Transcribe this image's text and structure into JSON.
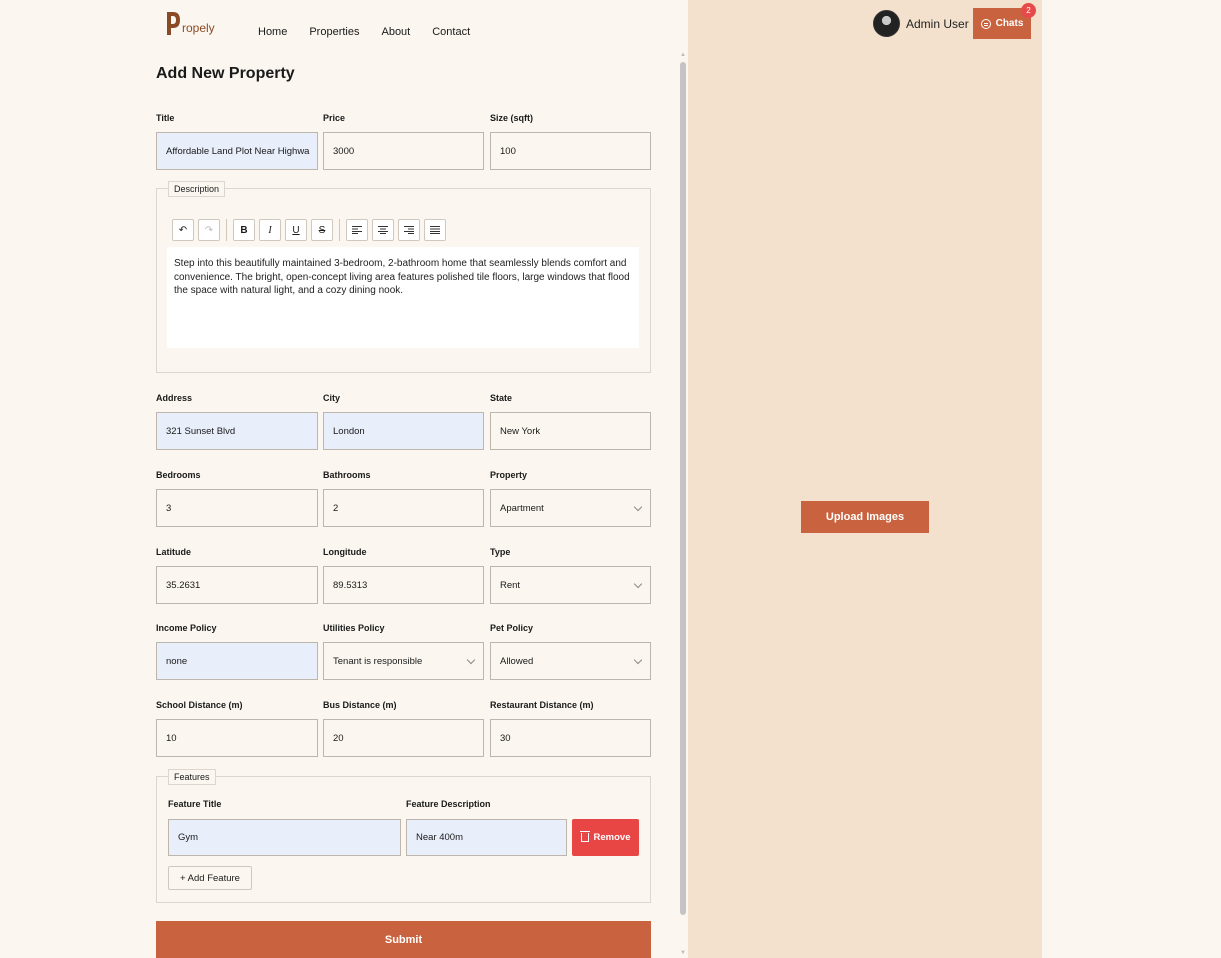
{
  "brand": {
    "logo_text": "ropely"
  },
  "nav": {
    "items": [
      "Home",
      "Properties",
      "About",
      "Contact"
    ]
  },
  "header": {
    "user_name": "Admin User",
    "chats_label": "Chats",
    "chats_badge": "2"
  },
  "form": {
    "title": "Add New Property",
    "fields": {
      "title": {
        "label": "Title",
        "value": "Affordable Land Plot Near Highwa"
      },
      "price": {
        "label": "Price",
        "value": "3000"
      },
      "size": {
        "label": "Size (sqft)",
        "value": "100"
      },
      "address": {
        "label": "Address",
        "value": "321 Sunset Blvd"
      },
      "city": {
        "label": "City",
        "value": "London"
      },
      "state": {
        "label": "State",
        "value": "New York"
      },
      "bedrooms": {
        "label": "Bedrooms",
        "value": "3"
      },
      "bathrooms": {
        "label": "Bathrooms",
        "value": "2"
      },
      "property": {
        "label": "Property",
        "value": "Apartment"
      },
      "latitude": {
        "label": "Latitude",
        "value": "35.2631"
      },
      "longitude": {
        "label": "Longitude",
        "value": "89.5313"
      },
      "type": {
        "label": "Type",
        "value": "Rent"
      },
      "income_policy": {
        "label": "Income Policy",
        "value": "none"
      },
      "utilities_policy": {
        "label": "Utilities Policy",
        "value": "Tenant is responsible"
      },
      "pet_policy": {
        "label": "Pet Policy",
        "value": "Allowed"
      },
      "school_distance": {
        "label": "School Distance (m)",
        "value": "10"
      },
      "bus_distance": {
        "label": "Bus Distance (m)",
        "value": "20"
      },
      "restaurant_distance": {
        "label": "Restaurant Distance (m)",
        "value": "30"
      }
    },
    "description": {
      "legend": "Description",
      "text": "Step into this beautifully maintained 3-bedroom, 2-bathroom home that seamlessly blends comfort and convenience. The bright, open-concept living area features polished tile floors, large windows that flood the space with natural light, and a cozy dining nook."
    },
    "features": {
      "legend": "Features",
      "title_label": "Feature Title",
      "description_label": "Feature Description",
      "items": [
        {
          "title": "Gym",
          "description": "Near 400m"
        }
      ],
      "remove_label": "Remove",
      "add_label": "+ Add Feature"
    },
    "submit_label": "Submit"
  },
  "upload": {
    "label": "Upload Images"
  },
  "colors": {
    "accent": "#c9623e",
    "danger": "#e84545",
    "panel": "#f3e1cd",
    "background": "#fbf7f0",
    "input_autofill": "#e8eefa"
  }
}
